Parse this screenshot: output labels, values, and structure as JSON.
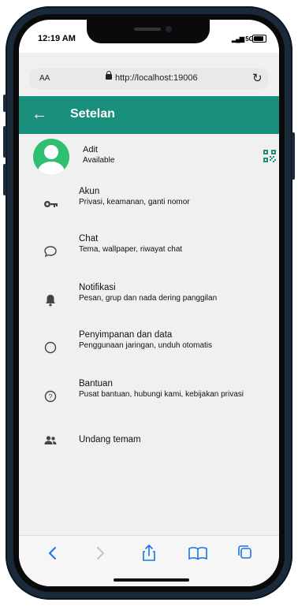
{
  "status_bar": {
    "time": "12:19 AM",
    "network": "5G"
  },
  "browser": {
    "text_size_label": "AA",
    "url": "http://localhost:19006"
  },
  "app_bar": {
    "title": "Setelan"
  },
  "profile": {
    "name": "Adit",
    "status": "Available"
  },
  "settings": [
    {
      "id": "akun",
      "icon": "key-icon",
      "label": "Akun",
      "sub": "Privasi, keamanan, ganti nomor"
    },
    {
      "id": "chat",
      "icon": "chat-bubble-icon",
      "label": "Chat",
      "sub": "Tema, wallpaper, riwayat chat"
    },
    {
      "id": "notifikasi",
      "icon": "bell-icon",
      "label": "Notifikasi",
      "sub": "Pesan, grup dan nada dering panggilan"
    },
    {
      "id": "penyimpanan",
      "icon": "circle-icon",
      "label": "Penyimpanan dan data",
      "sub": "Penggunaan jaringan, unduh otomatis"
    },
    {
      "id": "bantuan",
      "icon": "help-icon",
      "label": "Bantuan",
      "sub": "Pusat bantuan, hubungi kami, kebijakan privasi"
    },
    {
      "id": "undang",
      "icon": "people-icon",
      "label": "Undang temam",
      "sub": ""
    }
  ],
  "colors": {
    "accent": "#1a8f7c",
    "avatar": "#2fbf71",
    "browser_blue": "#1a73e8"
  }
}
